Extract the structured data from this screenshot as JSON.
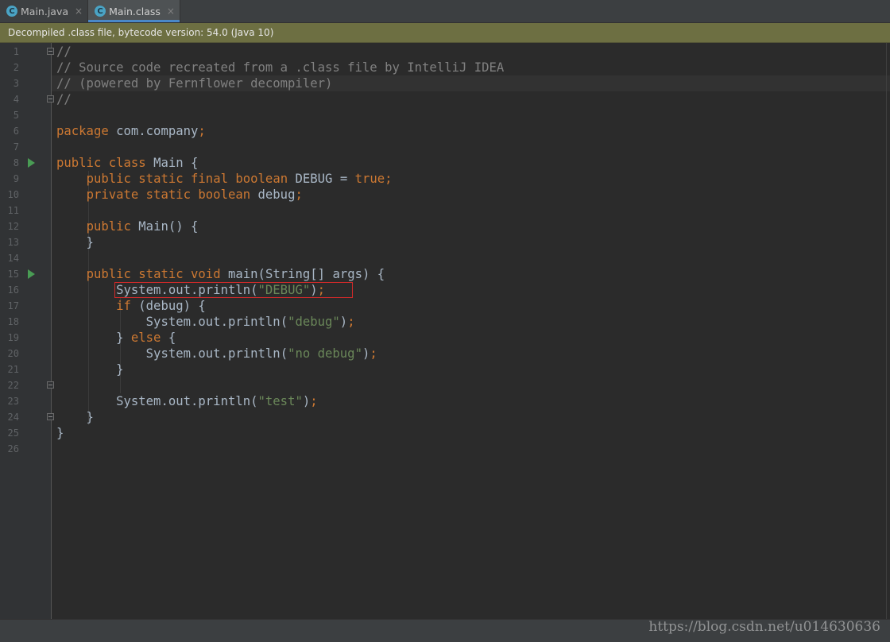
{
  "tabs": [
    {
      "icon": "class-file-icon",
      "glyph": "C",
      "label": "Main.java",
      "close": "×",
      "active": false
    },
    {
      "icon": "class-file-icon",
      "glyph": "C",
      "label": "Main.class",
      "close": "×",
      "active": true
    }
  ],
  "banner": {
    "text": "Decompiled .class file, bytecode version: 54.0 (Java 10)"
  },
  "editor": {
    "line_numbers": [
      "1",
      "2",
      "3",
      "4",
      "5",
      "6",
      "7",
      "8",
      "9",
      "10",
      "11",
      "12",
      "13",
      "14",
      "15",
      "16",
      "17",
      "18",
      "19",
      "20",
      "21",
      "22",
      "23",
      "24",
      "25",
      "26"
    ],
    "lines": [
      "//",
      "// Source code recreated from a .class file by IntelliJ IDEA",
      "// (powered by Fernflower decompiler)",
      "//",
      "",
      "package com.company;",
      "",
      "public class Main {",
      "    public static final boolean DEBUG = true;",
      "    private static boolean debug;",
      "",
      "    public Main() {",
      "    }",
      "",
      "    public static void main(String[] args) {",
      "        System.out.println(\"DEBUG\");",
      "        if (debug) {",
      "            System.out.println(\"debug\");",
      "        } else {",
      "            System.out.println(\"no debug\");",
      "        }",
      "",
      "        System.out.println(\"test\");",
      "    }",
      "}",
      ""
    ],
    "current_line": 3,
    "highlighted_line": 16,
    "run_gutter_lines": [
      8,
      15
    ],
    "fold_marker_lines": [
      1,
      4,
      22,
      24
    ]
  },
  "colors": {
    "keyword": "#cc7832",
    "string": "#6a8759",
    "comment": "#808080",
    "text": "#a9b7c6",
    "highlight_box": "#d12a2a"
  },
  "watermark": "https://blog.csdn.net/u014630636"
}
